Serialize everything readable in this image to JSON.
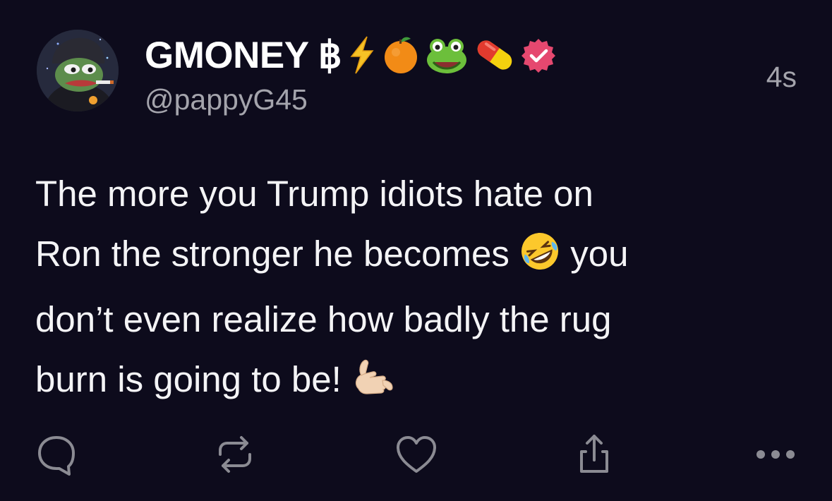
{
  "tweet": {
    "author": {
      "display_name": "GMONEY ฿",
      "handle": "@pappyG45",
      "name_emojis": [
        "lightning-emoji",
        "tangerine-emoji",
        "frog-emoji",
        "pill-emoji"
      ],
      "verified": true,
      "verified_badge_color": "#e5486f"
    },
    "timestamp": "4s",
    "text_lines": [
      "The more you Trump idiots hate on",
      "Ron the stronger he becomes ",
      " you",
      "don’t even realize how badly the rug",
      "burn is going to be! "
    ]
  },
  "actions": {
    "reply_icon": "speech-bubble-icon",
    "repost_icon": "repost-arrows-icon",
    "like_icon": "heart-icon",
    "share_icon": "share-upload-icon",
    "more_icon": "ellipsis-icon"
  },
  "colors": {
    "background": "#0d0b1c",
    "text": "#f4f4f6",
    "secondary_text": "#a4a4ac",
    "icon": "#8b8b93"
  }
}
